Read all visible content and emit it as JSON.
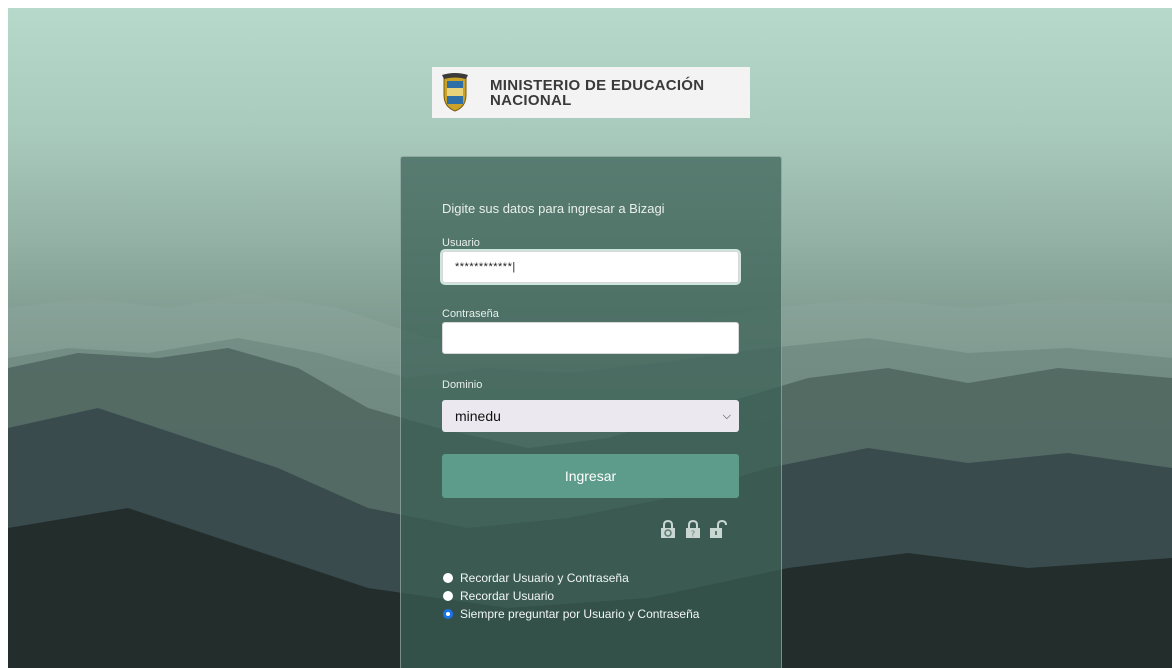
{
  "brand": {
    "line1": "MINISTERIO DE EDUCACIÓN",
    "line2": "NACIONAL"
  },
  "login": {
    "intro": "Digite sus datos para ingresar a Bizagi",
    "user_label": "Usuario",
    "user_value": "************|",
    "password_label": "Contraseña",
    "password_value": "",
    "domain_label": "Dominio",
    "domain_value": "minedu",
    "submit_label": "Ingresar"
  },
  "lock_icons": [
    "lock-refresh-icon",
    "lock-question-icon",
    "unlock-icon"
  ],
  "remember_options": [
    {
      "label": "Recordar Usuario y Contraseña",
      "checked": false
    },
    {
      "label": "Recordar Usuario",
      "checked": false
    },
    {
      "label": "Siempre preguntar por Usuario y Contraseña",
      "checked": true
    }
  ],
  "colors": {
    "button": "#5d9b8b",
    "panel": "#3a6054",
    "radio_checked": "#1a73e8"
  }
}
